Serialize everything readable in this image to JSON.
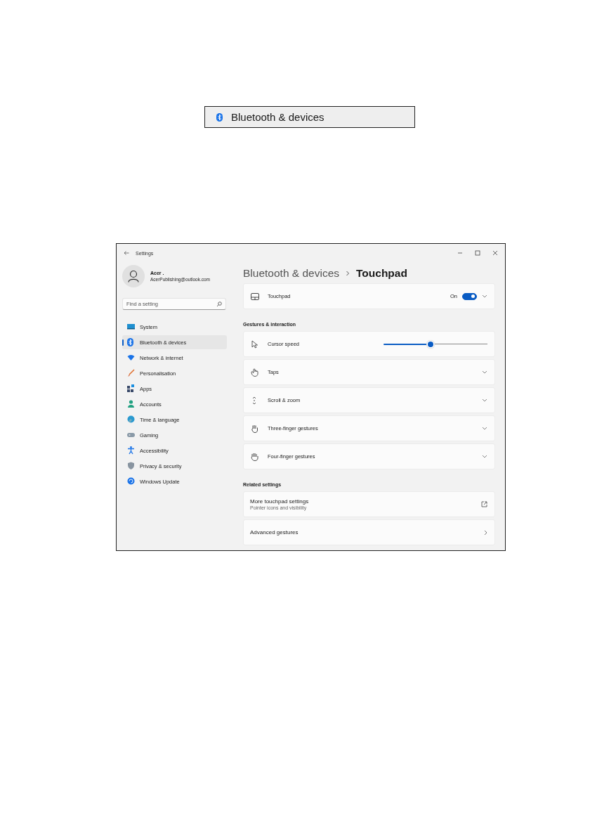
{
  "snippet": {
    "label": "Bluetooth & devices"
  },
  "window": {
    "title": "Settings"
  },
  "profile": {
    "name": "Acer .",
    "email": "AcerPublishing@outlook.com"
  },
  "search": {
    "placeholder": "Find a setting"
  },
  "nav": [
    {
      "label": "System",
      "selected": false
    },
    {
      "label": "Bluetooth & devices",
      "selected": true
    },
    {
      "label": "Network & internet",
      "selected": false
    },
    {
      "label": "Personalisation",
      "selected": false
    },
    {
      "label": "Apps",
      "selected": false
    },
    {
      "label": "Accounts",
      "selected": false
    },
    {
      "label": "Time & language",
      "selected": false
    },
    {
      "label": "Gaming",
      "selected": false
    },
    {
      "label": "Accessibility",
      "selected": false
    },
    {
      "label": "Privacy & security",
      "selected": false
    },
    {
      "label": "Windows Update",
      "selected": false
    }
  ],
  "breadcrumb": {
    "parent": "Bluetooth & devices",
    "current": "Touchpad"
  },
  "touchpad": {
    "label": "Touchpad",
    "state": "On",
    "on": true
  },
  "sections": [
    {
      "heading": "Gestures & interaction",
      "cards": [
        {
          "kind": "slider",
          "label": "Cursor speed",
          "level": 0.45
        },
        {
          "kind": "expand",
          "label": "Taps"
        },
        {
          "kind": "expand",
          "label": "Scroll & zoom"
        },
        {
          "kind": "expand",
          "label": "Three-finger gestures"
        },
        {
          "kind": "expand",
          "label": "Four-finger gestures"
        }
      ]
    },
    {
      "heading": "Related settings",
      "cards": [
        {
          "kind": "link",
          "label": "More touchpad settings",
          "description": "Pointer icons and visibility"
        },
        {
          "kind": "nav",
          "label": "Advanced gestures"
        }
      ]
    }
  ]
}
